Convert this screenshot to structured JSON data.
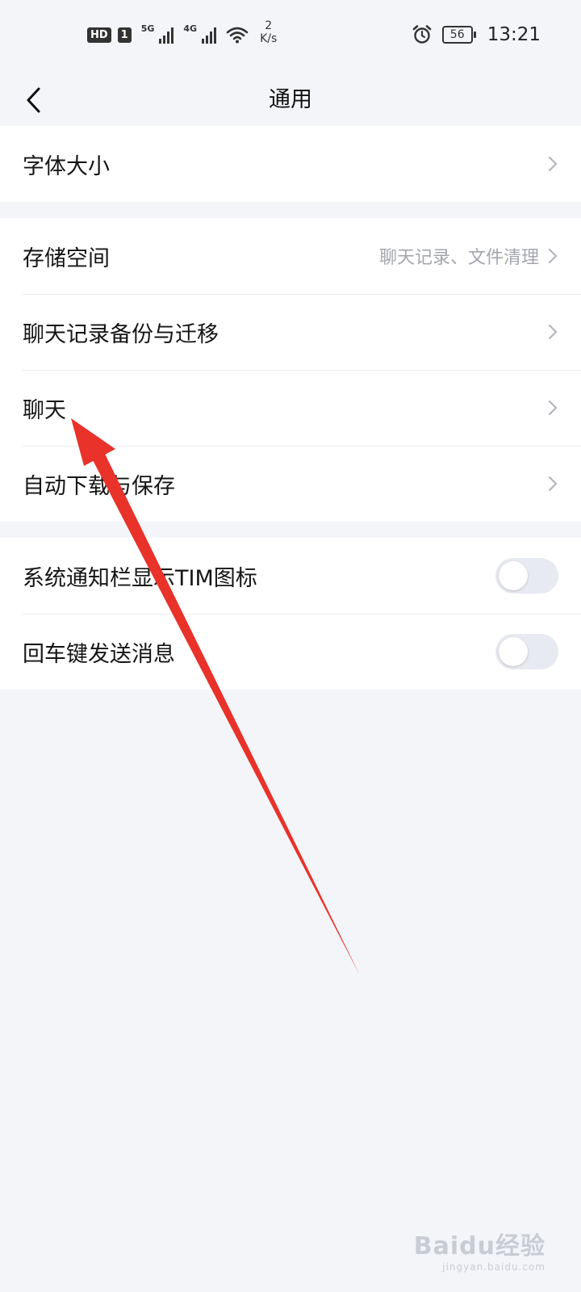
{
  "status_bar": {
    "hd": "HD",
    "sim": "1",
    "net1": "5G",
    "net2": "4G",
    "speed_value": "2",
    "speed_unit": "K/s",
    "battery": "56",
    "time": "13:21",
    "icons": [
      "signal-icon",
      "wifi-icon",
      "alarm-icon",
      "battery-icon"
    ]
  },
  "header": {
    "title": "通用"
  },
  "groups": {
    "display": {
      "font_size": "字体大小"
    },
    "storage": {
      "storage_space": "存储空间",
      "storage_hint": "聊天记录、文件清理",
      "backup": "聊天记录备份与迁移",
      "chat": "聊天",
      "auto_download": "自动下载与保存"
    },
    "switches": {
      "notify_icon": "系统通知栏显示TIM图标",
      "notify_icon_on": false,
      "enter_send": "回车键发送消息",
      "enter_send_on": false
    }
  },
  "watermark": {
    "brand": "Baidu经验",
    "url": "jingyan.baidu.com"
  },
  "colors": {
    "background": "#f4f5f9",
    "card": "#ffffff",
    "text": "#151515",
    "secondary_text": "#a4a6ad",
    "toggle_off": "#e8eaf1",
    "annotation_arrow": "#e8322a"
  }
}
